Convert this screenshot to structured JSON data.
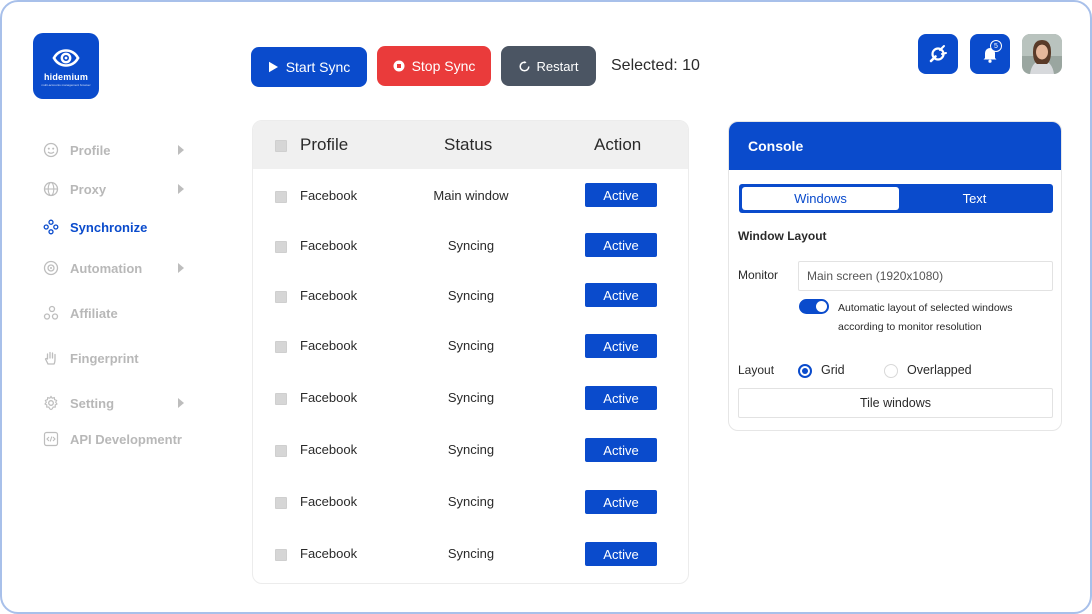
{
  "brand": {
    "name": "hidemium",
    "tagline": "multi-accounts management browser"
  },
  "sidebar": {
    "items": [
      {
        "label": "Profile",
        "icon": "profile-icon",
        "has_submenu": true,
        "active": false
      },
      {
        "label": "Proxy",
        "icon": "globe-icon",
        "has_submenu": true,
        "active": false
      },
      {
        "label": "Synchronize",
        "icon": "sync-icon",
        "has_submenu": false,
        "active": true
      },
      {
        "label": "Automation",
        "icon": "automation-icon",
        "has_submenu": true,
        "active": false
      },
      {
        "label": "Affiliate",
        "icon": "affiliate-icon",
        "has_submenu": false,
        "active": false
      },
      {
        "label": "Fingerprint",
        "icon": "hand-icon",
        "has_submenu": false,
        "active": false
      },
      {
        "label": "Setting",
        "icon": "gear-icon",
        "has_submenu": true,
        "active": false
      },
      {
        "label": "API Developmentr",
        "icon": "code-icon",
        "has_submenu": false,
        "active": false
      }
    ]
  },
  "toolbar": {
    "start_label": "Start Sync",
    "stop_label": "Stop Sync",
    "restart_label": "Restart",
    "selected_label": "Selected: 10"
  },
  "header": {
    "notification_count": "5"
  },
  "table": {
    "columns": [
      "Profile",
      "Status",
      "Action"
    ],
    "rows": [
      {
        "profile": "Facebook",
        "status": "Main window",
        "action": "Active"
      },
      {
        "profile": "Facebook",
        "status": "Syncing",
        "action": "Active"
      },
      {
        "profile": "Facebook",
        "status": "Syncing",
        "action": "Active"
      },
      {
        "profile": "Facebook",
        "status": "Syncing",
        "action": "Active"
      },
      {
        "profile": "Facebook",
        "status": "Syncing",
        "action": "Active"
      },
      {
        "profile": "Facebook",
        "status": "Syncing",
        "action": "Active"
      },
      {
        "profile": "Facebook",
        "status": "Syncing",
        "action": "Active"
      },
      {
        "profile": "Facebook",
        "status": "Syncing",
        "action": "Active"
      }
    ]
  },
  "console": {
    "title": "Console",
    "tabs": [
      "Windows",
      "Text"
    ],
    "active_tab": "Windows",
    "section_title": "Window Layout",
    "monitor_label": "Monitor",
    "monitor_value": "Main screen (1920x1080)",
    "auto_layout_line1": "Automatic layout of selected windows",
    "auto_layout_line2": "according to monitor resolution",
    "auto_layout_enabled": true,
    "layout_label": "Layout",
    "layout_options": [
      "Grid",
      "Overlapped"
    ],
    "layout_selected": "Grid",
    "tile_label": "Tile windows"
  },
  "colors": {
    "primary": "#0a4bcc",
    "danger": "#ea3b3b",
    "neutral_button": "#4b5563",
    "sidebar_inactive": "#b8b8b8",
    "frame_border": "#a8c0ea"
  }
}
